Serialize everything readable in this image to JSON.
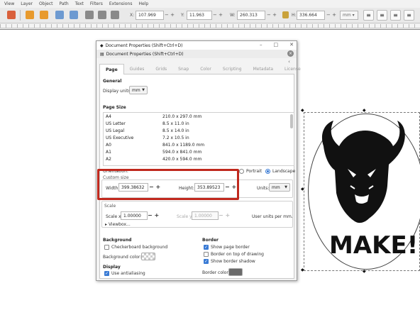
{
  "menubar": {
    "items": [
      "View",
      "Layer",
      "Object",
      "Path",
      "Text",
      "Filters",
      "Extensions",
      "Help"
    ]
  },
  "toolbar": {
    "x_label": "X:",
    "x_value": "107.969",
    "y_label": "Y:",
    "y_value": "11.963",
    "w_label": "W:",
    "w_value": "260.313",
    "h_label": "H:",
    "h_value": "336.664",
    "unit": "mm",
    "minus": "−",
    "plus": "+"
  },
  "canvas": {
    "make_text": "MAKE!"
  },
  "dialog": {
    "window_title": "Document Properties (Shift+Ctrl+D)",
    "panel_title": "Document Properties (Shift+Ctrl+D)",
    "tabs": [
      "Page",
      "Guides",
      "Grids",
      "Snap",
      "Color",
      "Scripting",
      "Metadata",
      "License"
    ],
    "general": {
      "title": "General",
      "display_units_label": "Display units:",
      "display_units_value": "mm"
    },
    "page_size": {
      "title": "Page Size",
      "rows": [
        {
          "name": "A4",
          "size": "210.0 x 297.0 mm"
        },
        {
          "name": "US Letter",
          "size": "8.5 x 11.0 in"
        },
        {
          "name": "US Legal",
          "size": "8.5 x 14.0 in"
        },
        {
          "name": "US Executive",
          "size": "7.2 x 10.5 in"
        },
        {
          "name": "A0",
          "size": "841.0 x 1189.0 mm"
        },
        {
          "name": "A1",
          "size": "594.0 x 841.0 mm"
        },
        {
          "name": "A2",
          "size": "420.0 x 594.0 mm"
        }
      ]
    },
    "orientation": {
      "label": "Orientation:",
      "portrait": "Portrait",
      "landscape": "Landscape"
    },
    "custom_size": {
      "title": "Custom size",
      "width_label": "Width:",
      "width_value": "399.38632",
      "height_label": "Height:",
      "height_value": "353.89523",
      "units_label": "Units:",
      "units_value": "mm"
    },
    "scale": {
      "title": "Scale",
      "x_label": "Scale x:",
      "x_value": "1.00000",
      "y_label": "Scale y:",
      "y_value": "1.00000",
      "user_units": "User units per mm.",
      "viewbox": "Viewbox..."
    },
    "background": {
      "title": "Background",
      "checkerboard": "Checkerboard background",
      "color_label": "Background color:"
    },
    "border": {
      "title": "Border",
      "show_border": "Show page border",
      "on_top": "Border on top of drawing",
      "shadow": "Show border shadow",
      "color_label": "Border color:"
    },
    "display": {
      "title": "Display",
      "antialias": "Use antialiasing"
    }
  },
  "colors": {
    "highlight": "#c0281d",
    "accent": "#3a7bd5",
    "border_swatch": "#6a6a6a"
  },
  "icons": [
    "inkscape-logo-icon",
    "minimize-icon",
    "maximize-icon",
    "close-icon",
    "bison-head-icon"
  ]
}
